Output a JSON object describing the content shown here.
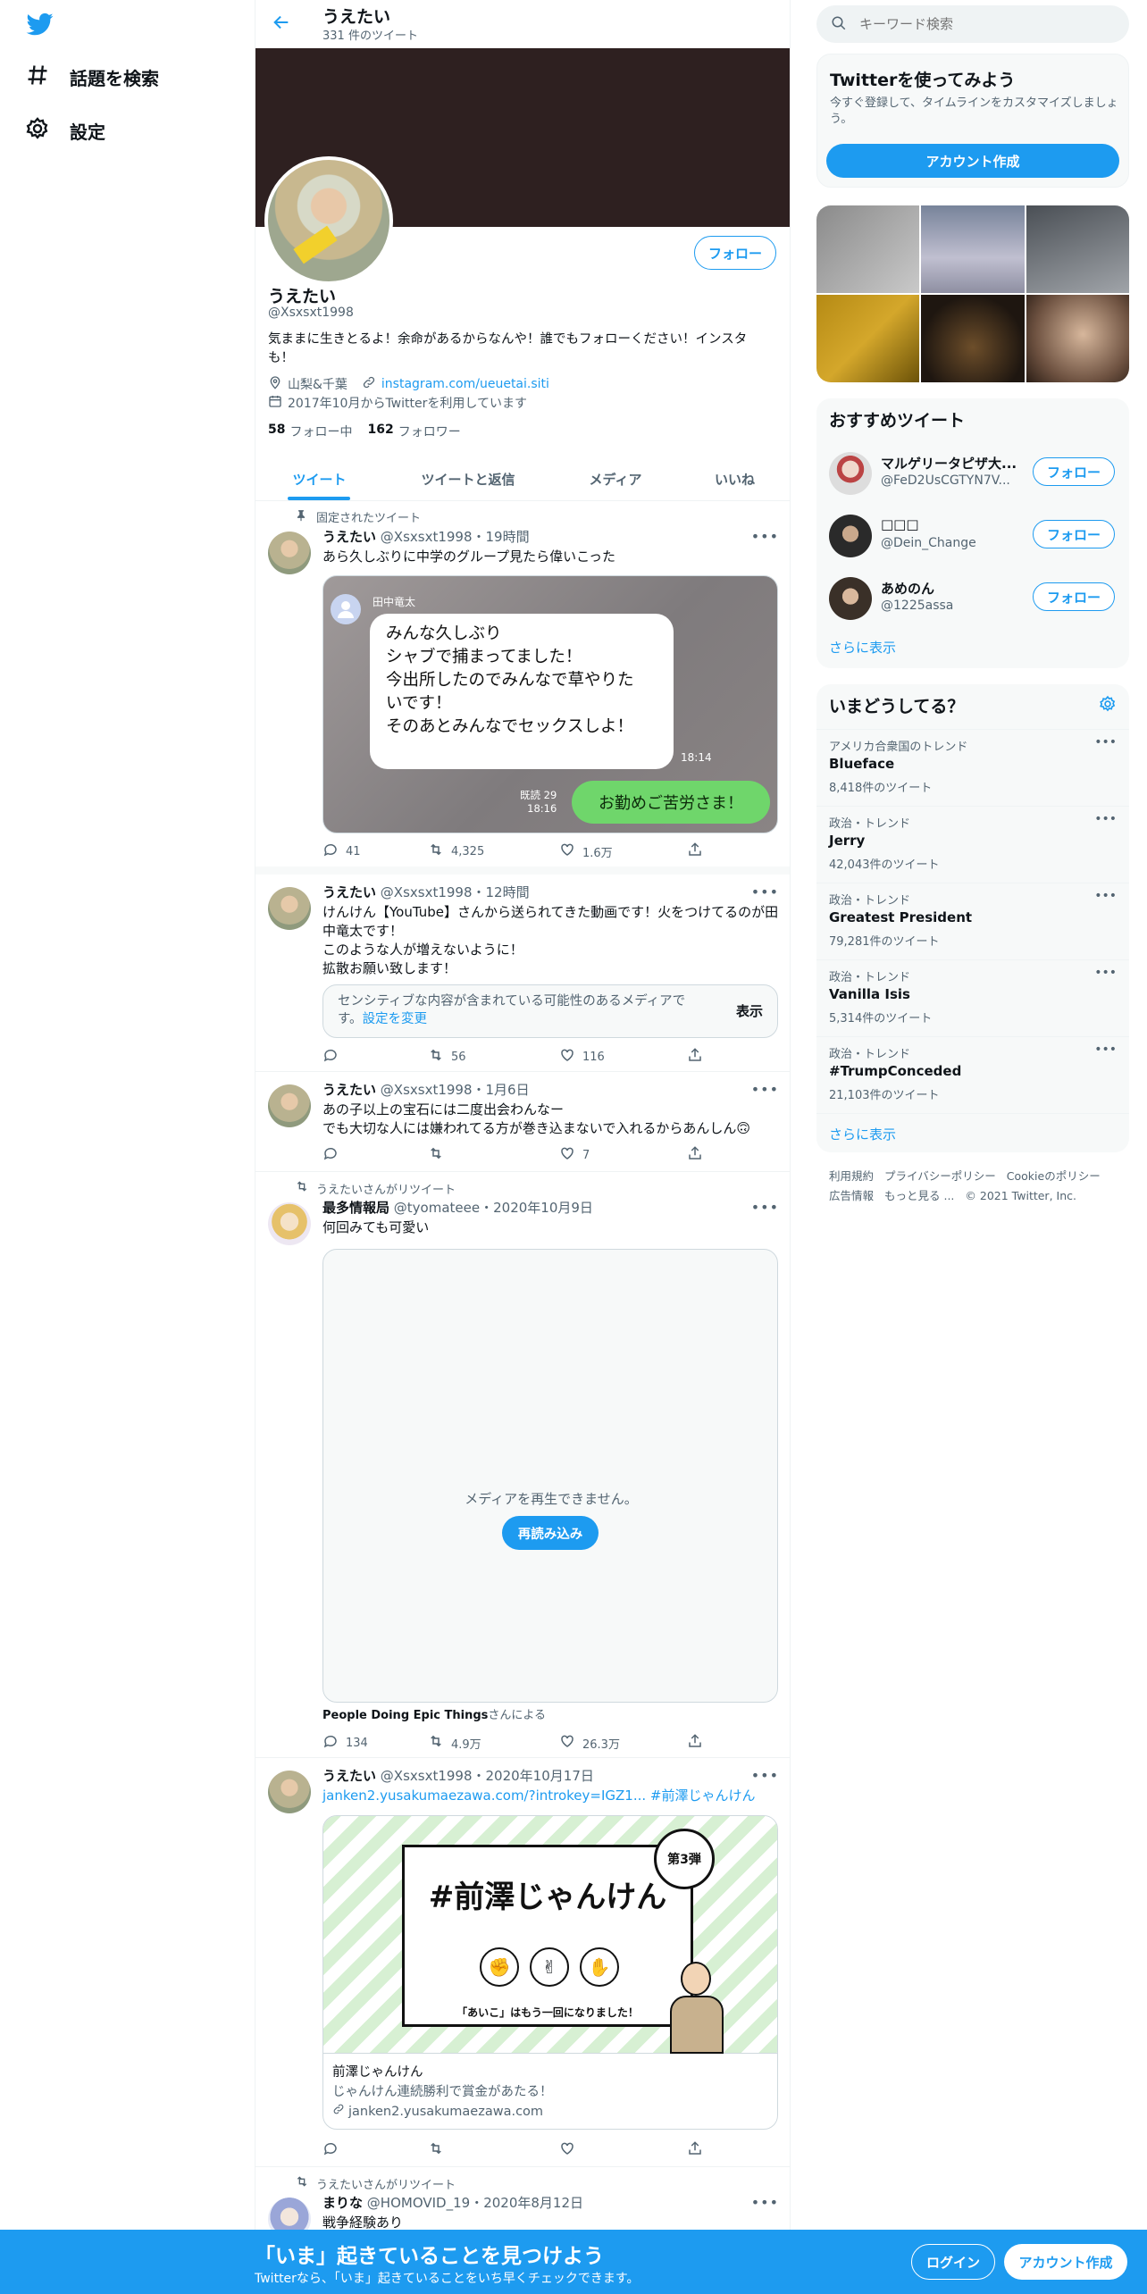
{
  "nav": {
    "explore_label": "話題を検索",
    "settings_label": "設定"
  },
  "header": {
    "name": "うえたい",
    "tweet_count": "331 件のツイート"
  },
  "profile": {
    "name": "うえたい",
    "handle": "@Xsxsxt1998",
    "follow_label": "フォロー",
    "bio_line1": "気ままに生きとるよ！余命があるからなんや！誰でもフォローください！インスタ",
    "bio_line2": "も！",
    "location": "山梨&千葉",
    "link": "instagram.com/ueuetai.siti",
    "joined": "2017年10月からTwitterを利用しています",
    "following_count": "58",
    "following_label": "フォロー中",
    "followers_count": "162",
    "followers_label": "フォロワー"
  },
  "tabs": [
    "ツイート",
    "ツイートと返信",
    "メディア",
    "いいね"
  ],
  "tweets": {
    "t1": {
      "pinned_label": "固定されたツイート",
      "name": "うえたい",
      "meta": "@Xsxsxt1998・19時間",
      "text": "あら久しぶりに中学のグループ見たら偉いこった",
      "chat_sender": "田中竜太",
      "chat_lines": [
        "みんな久しぶり",
        "シャブで捕まってました！",
        "今出所したのでみんなで草やりた",
        "いです！",
        "そのあとみんなでセックスしよ！"
      ],
      "chat_time1": "18:14",
      "chat_read": "既読 29",
      "chat_time2": "18:16",
      "chat_reply": "お勤めご苦労さま！",
      "replies": "41",
      "retweets": "4,325",
      "likes": "1.6万"
    },
    "t2": {
      "name": "うえたい",
      "meta": "@Xsxsxt1998・12時間",
      "lines": [
        "けんけん【YouTube】さんから送られてきた動画です！火をつけてるのが田",
        "中竜太です！",
        "このような人が増えないように！",
        "拡散お願い致します！"
      ],
      "sensitive_line1": "センシティブな内容が含まれている可能性のあるメディアで",
      "sensitive_line2_pre": "す。",
      "sensitive_link": "設定を変更",
      "show_label": "表示",
      "retweets": "56",
      "likes": "116"
    },
    "t3": {
      "name": "うえたい",
      "meta": "@Xsxsxt1998・1月6日",
      "line1": "あの子以上の宝石には二度出会わんなー",
      "line2": "でも大切な人には嫌われてる方が巻き込まないで入れるからあんしん🙃",
      "likes": "7"
    },
    "t4": {
      "retweet_label": "うえたいさんがリツイート",
      "name": "最多情報局",
      "meta": "@tyomateee・2020年10月9日",
      "text": "何回みても可愛い",
      "media_error": "メディアを再生できません。",
      "reload_label": "再読み込み",
      "source_name": "People Doing Epic Things",
      "source_suffix": "さんによる",
      "replies": "134",
      "retweets": "4.9万",
      "likes": "26.3万"
    },
    "t5": {
      "name": "うえたい",
      "meta": "@Xsxsxt1998・2020年10月17日",
      "link_text": "janken2.yusakumaezawa.com/?introkey=IGZ1...",
      "hashtag": "#前澤じゃんけん",
      "card_title_big": "#前澤じゃんけん",
      "card_badge": "第3弾",
      "card_caption": "「あいこ」はもう一回になりました！",
      "card_title": "前澤じゃんけん",
      "card_desc": "じゃんけん連続勝利で賞金があたる！",
      "card_domain": "janken2.yusakumaezawa.com"
    },
    "t6": {
      "retweet_label": "うえたいさんがリツイート",
      "name": "まりな",
      "meta": "@HOMOVID_19・2020年8月12日",
      "text": "戦争経験あり"
    }
  },
  "right": {
    "search_placeholder": "キーワード検索",
    "signup_title": "Twitterを使ってみよう",
    "signup_desc_line1": "今すぐ登録して、タイムラインをカスタマイズしましょ",
    "signup_desc_line2": "う。",
    "signup_button": "アカウント作成",
    "who_title": "おすすめツイート",
    "who": [
      {
        "name": "マルゲリータピザ大...",
        "handle": "@FeD2UsCGTYN7V...",
        "button": "フォロー"
      },
      {
        "name": "□□□",
        "handle": "@Dein_Change",
        "button": "フォロー"
      },
      {
        "name": "あめのん",
        "handle": "@1225assa",
        "button": "フォロー"
      }
    ],
    "show_more": "さらに表示",
    "trends_title": "いまどうしてる？",
    "trends": [
      {
        "context": "アメリカ合衆国のトレンド",
        "name": "Blueface",
        "count": "8,418件のツイート"
      },
      {
        "context": "政治・トレンド",
        "name": "Jerry",
        "count": "42,043件のツイート"
      },
      {
        "context": "政治・トレンド",
        "name": "Greatest President",
        "count": "79,281件のツイート"
      },
      {
        "context": "政治・トレンド",
        "name": "Vanilla Isis",
        "count": "5,314件のツイート"
      },
      {
        "context": "政治・トレンド",
        "name": "#TrumpConceded",
        "count": "21,103件のツイート"
      }
    ],
    "trends_more": "さらに表示",
    "footer": {
      "terms": "利用規約",
      "privacy": "プライバシーポリシー",
      "cookie": "Cookieのポリシー",
      "ads": "広告情報",
      "more": "もっと見る ...",
      "copyright": "© 2021 Twitter, Inc."
    }
  },
  "bottom": {
    "title": "「いま」起きていることを見つけよう",
    "subtitle": "Twitterなら、「いま」起きていることをいち早くチェックできます。",
    "login": "ログイン",
    "signup": "アカウント作成"
  },
  "colors": {
    "accent": "#1d9bf0",
    "banner": "#2e2020",
    "chat_bg": "#8c8888",
    "chat_reply": "#6fd66b"
  }
}
